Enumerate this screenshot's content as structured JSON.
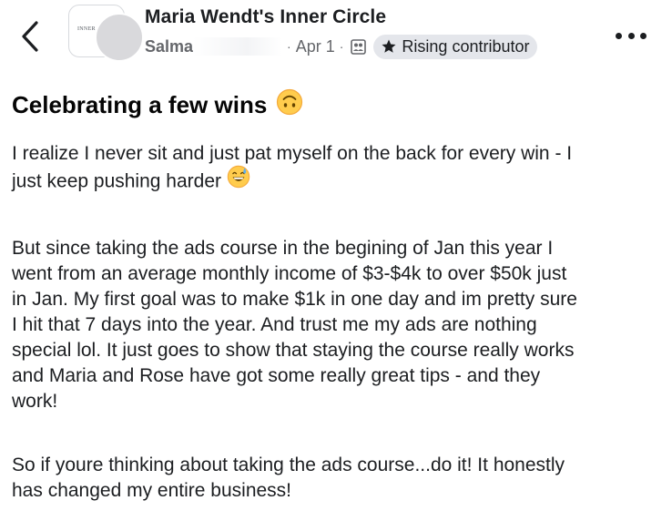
{
  "header": {
    "group_name": "Maria Wendt's Inner Circle",
    "group_thumb_text": "INNER",
    "author_name": "Salma",
    "separator": "·",
    "date": "Apr 1",
    "badge_label": "Rising contributor"
  },
  "icons": {
    "back": "chevron-left-icon",
    "audience": "group-members-icon",
    "badge": "star-icon",
    "more": "more-dots-icon",
    "title_emoji": "upside-down-face-emoji-icon",
    "body_emoji": "grinning-sweat-emoji-icon"
  },
  "post": {
    "title": "Celebrating a few wins",
    "paragraphs": [
      {
        "lines": [
          "I realize I never sit and just pat myself on the back for every win - I",
          "just keep pushing harder"
        ]
      },
      {
        "lines": [
          "But since taking the ads course in the begining of Jan this year I",
          "went from an average monthly income of $3-$4k to over $50k just",
          "in Jan. My first goal was to make $1k in one day and im pretty sure",
          "I hit that 7 days into the year. And trust me my ads are nothing",
          "special lol. It just goes to show that staying the course really works",
          "and Maria and Rose have got some really great tips - and they",
          "work!"
        ]
      },
      {
        "lines": [
          "So if youre thinking about taking the ads course...do it! It honestly",
          "has changed my entire business!"
        ]
      }
    ]
  },
  "colors": {
    "text_primary": "#1c1e21",
    "text_secondary": "#65676b",
    "badge_bg": "#e4e6eb",
    "emoji_yellow": "#ffcc4d"
  }
}
